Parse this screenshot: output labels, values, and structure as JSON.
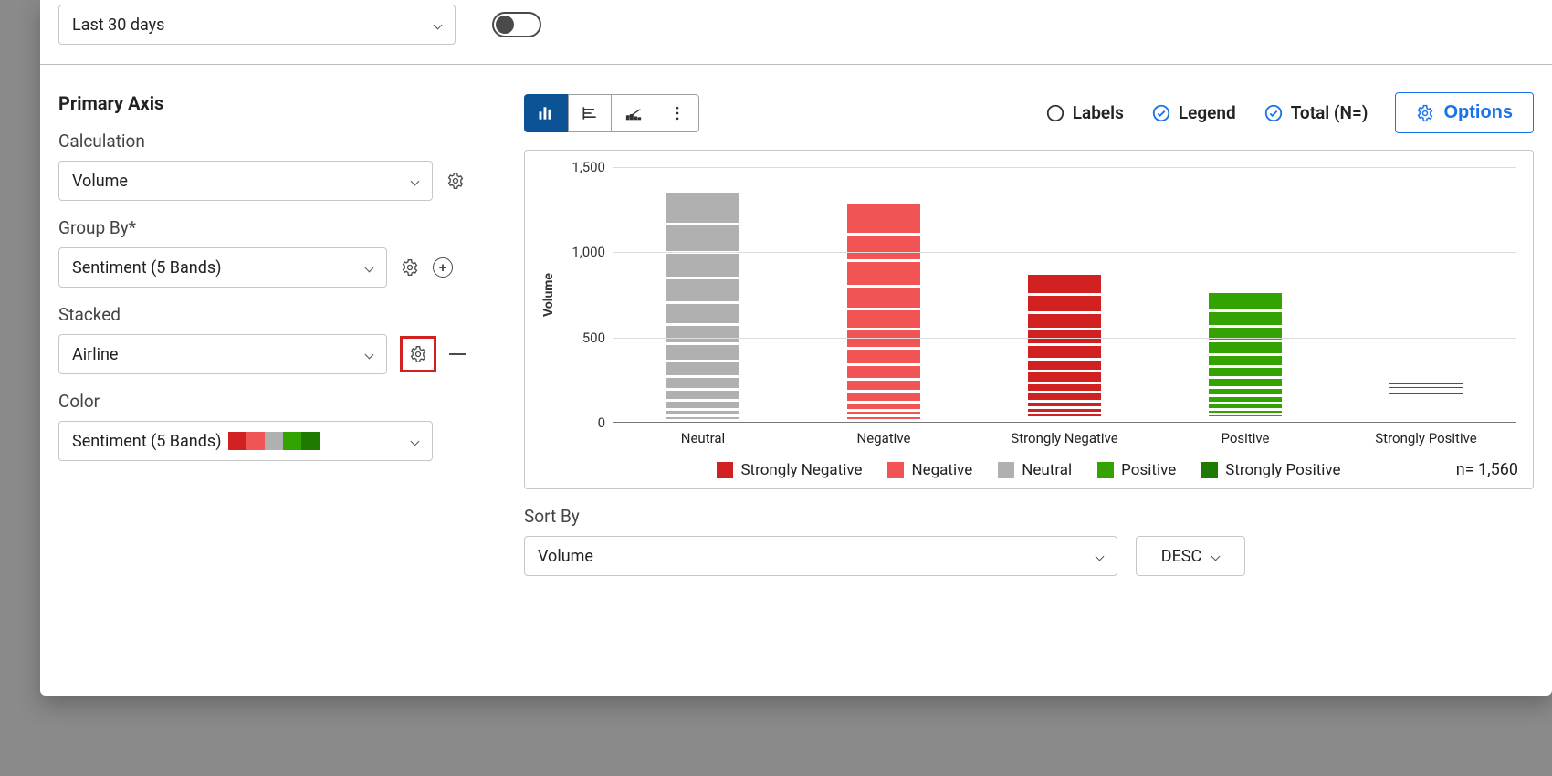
{
  "topbar": {
    "date_range": "Last 30 days"
  },
  "sidebar": {
    "title": "Primary Axis",
    "calculation_label": "Calculation",
    "calculation_value": "Volume",
    "group_by_label": "Group By*",
    "group_by_value": "Sentiment (5 Bands)",
    "stacked_label": "Stacked",
    "stacked_value": "Airline",
    "color_label": "Color",
    "color_value": "Sentiment (5 Bands)",
    "color_swatches": [
      "#d02020",
      "#f05454",
      "#b0b0b0",
      "#32a300",
      "#1e7a00"
    ]
  },
  "toolbar": {
    "labels": "Labels",
    "legend": "Legend",
    "total": "Total (N=)",
    "options": "Options"
  },
  "chart_data": {
    "type": "bar",
    "ylabel": "Volume",
    "categories": [
      "Neutral",
      "Negative",
      "Strongly Negative",
      "Positive",
      "Strongly Positive"
    ],
    "category_colors": [
      "#b0b0b0",
      "#f05454",
      "#d02020",
      "#32a300",
      "#1e7a00"
    ],
    "values": [
      1350,
      1280,
      870,
      760,
      230
    ],
    "segments_per_bar": 14,
    "yticks": [
      0,
      500,
      1000,
      1500
    ],
    "ylim": [
      0,
      1500
    ],
    "legend": [
      {
        "name": "Strongly Negative",
        "color": "#d02020"
      },
      {
        "name": "Negative",
        "color": "#f05454"
      },
      {
        "name": "Neutral",
        "color": "#b0b0b0"
      },
      {
        "name": "Positive",
        "color": "#32a300"
      },
      {
        "name": "Strongly Positive",
        "color": "#1e7a00"
      }
    ],
    "n_label": "n= 1,560"
  },
  "sort": {
    "label": "Sort By",
    "by": "Volume",
    "dir": "DESC"
  }
}
